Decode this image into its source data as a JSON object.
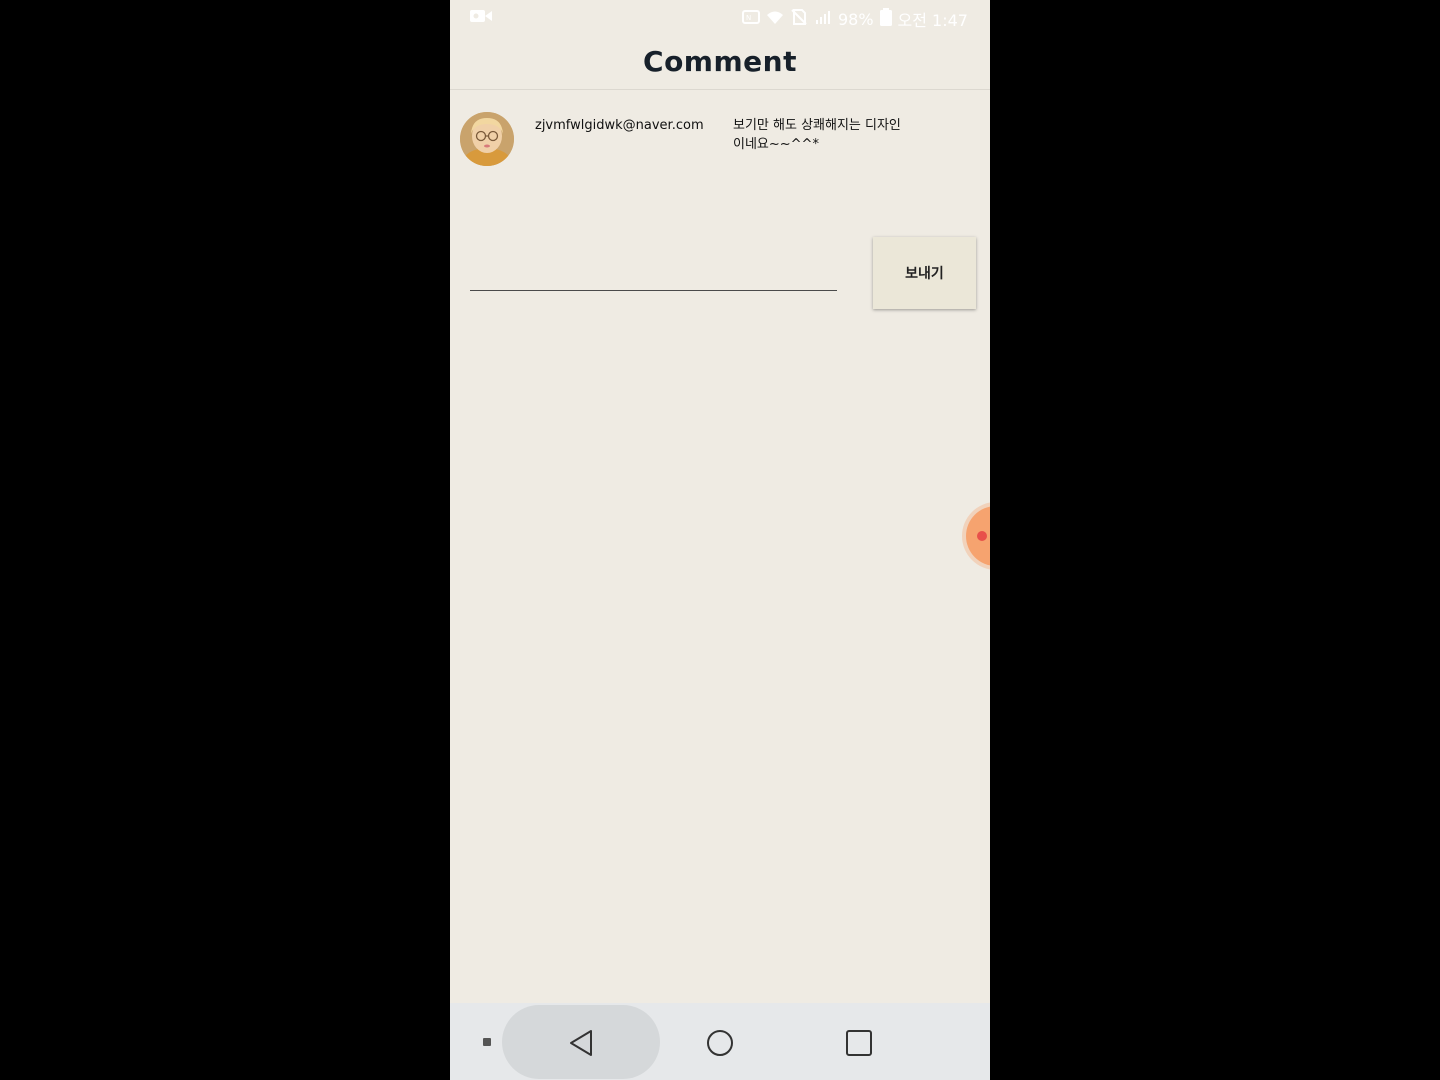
{
  "status_bar": {
    "battery": "98%",
    "time": "오전 1:47"
  },
  "header": {
    "title": "Comment"
  },
  "comments": [
    {
      "email": "zjvmfwlgidwk@naver.com",
      "text": "보기만 해도 상쾌해지는 디자인이네요~~^^*"
    }
  ],
  "composer": {
    "input_value": "",
    "send_label": "보내기"
  },
  "colors": {
    "background": "#efebe3",
    "send_button": "#ebe7d8",
    "title_text": "#17202a",
    "floating_bubble": "#f6a36f"
  },
  "icons": {
    "status": [
      "screen-record-icon",
      "nfc-icon",
      "wifi-icon",
      "no-sim-icon",
      "signal-icon",
      "battery-icon"
    ],
    "navigation": [
      "back-icon",
      "home-icon",
      "recent-apps-icon"
    ]
  }
}
